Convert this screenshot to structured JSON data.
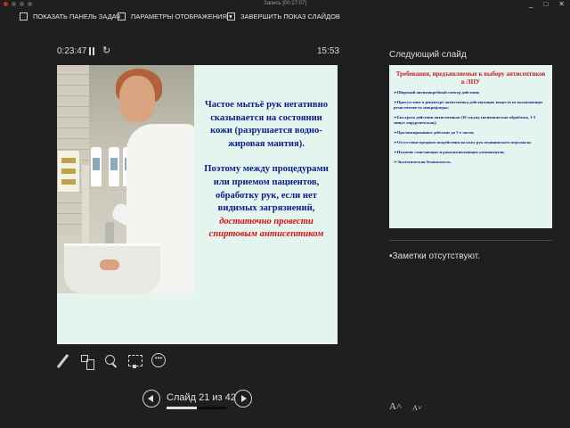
{
  "window": {
    "title": "Запись [00:27:07]",
    "controls": {
      "minimize": "_",
      "restore": "□",
      "close": "✕"
    }
  },
  "toolbar": {
    "show_taskbar": "ПОКАЗАТЬ ПАНЕЛЬ ЗАДАЧ",
    "display_settings": "ПАРАМЕТРЫ ОТОБРАЖЕНИЯ ▾",
    "end_show": "ЗАВЕРШИТЬ ПОКАЗ СЛАЙДОВ"
  },
  "timer": {
    "elapsed": "0:23:47",
    "clock": "15:53"
  },
  "current_slide": {
    "paragraph1": "Частое мытьё рук негативно сказывается на состоянии кожи (разрушается водно-жировая мантия).",
    "paragraph2_prefix": "Поэтому между процедурами или приемом пациентов, обработку рук, если нет видимых загрязнений,",
    "paragraph2_emphasis": "достаточно провести спиртовым антисептиком"
  },
  "tools": {
    "pen": "pen-icon",
    "see_all_slides": "slides-icon",
    "zoom": "zoom-icon",
    "black_screen": "screen-icon",
    "more": "more-icon"
  },
  "navigation": {
    "counter": "Слайд 21 из 42",
    "current": 21,
    "total": 42
  },
  "next_slide": {
    "heading": "Следующий слайд",
    "title": "Требования, предъявляемые к выбору антисептиков в ЛПУ",
    "items": [
      "➢Широкий антимикробный спектр действия;",
      "➢Присутствие в рецептуре антисептика действующих веществ не вызывающих резистентность микрофлоры;",
      "➢Быстрота действия антисептиков (30 секунд гигиеническая обработка, 3-5 минут хирургическая);",
      "➢Пролонгированное действие до 3-х часов;",
      "➢Отсутствие вредного воздействия на кожу рук медицинского персонала;",
      "➢Наличие смягчающих и ранозаживляющих компонентов;",
      "➢Экологическая безопасность."
    ]
  },
  "notes": {
    "text": "•Заметки отсутствуют."
  },
  "font_buttons": {
    "increase": "A˄",
    "decrease": "A˅"
  }
}
